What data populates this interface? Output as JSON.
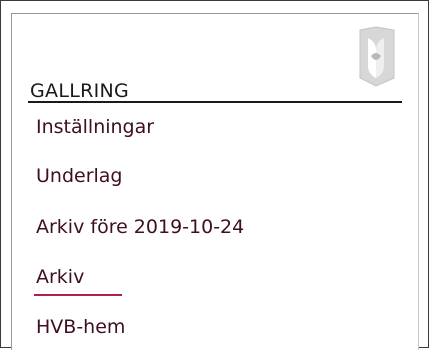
{
  "section": {
    "title": "GALLRING"
  },
  "menu": {
    "items": [
      {
        "label": "Inställningar"
      },
      {
        "label": "Underlag"
      },
      {
        "label": "Arkiv före 2019-10-24"
      },
      {
        "label": "Arkiv"
      },
      {
        "label": "HVB-hem"
      }
    ],
    "active_item": "Arkiv"
  },
  "colors": {
    "menu_text": "#3d0f24",
    "active_underline": "#b0204a",
    "rule": "#1a1a1a"
  },
  "icons": {
    "logo": "logo-icon"
  }
}
